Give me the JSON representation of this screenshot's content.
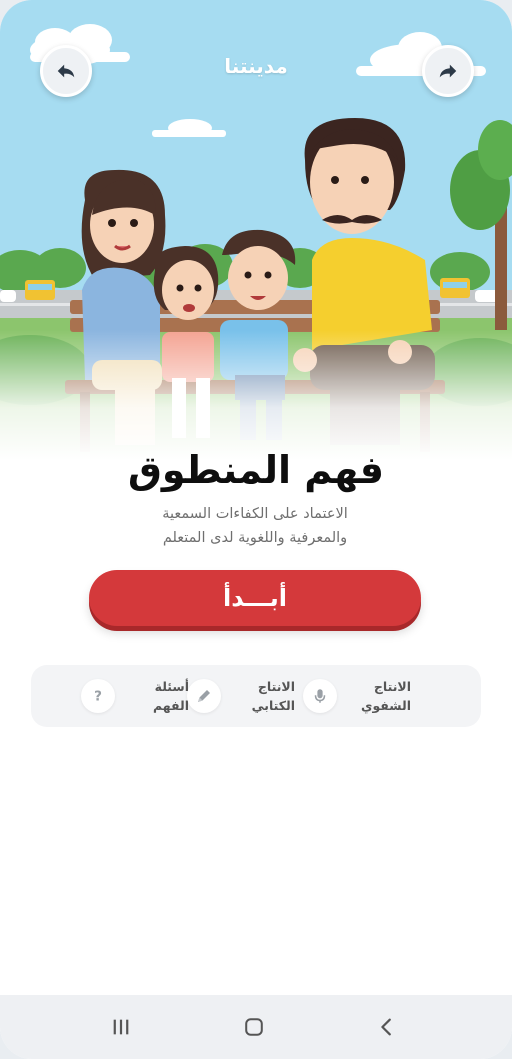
{
  "header": {
    "title": "مدينتنا",
    "back_icon": "arrow-back-icon",
    "forward_icon": "arrow-forward-icon"
  },
  "lesson": {
    "title": "فهم المنطوق",
    "subtitle_line1": "الاعتماد على الكفاءات السمعية",
    "subtitle_line2": "والمعرفية واللغوية لدى المتعلم"
  },
  "actions": {
    "start_label": "أبـــدأ"
  },
  "features": [
    {
      "label_line1": "الانتاج",
      "label_line2": "الشفوي",
      "icon": "microphone-icon"
    },
    {
      "label_line1": "الانتاج",
      "label_line2": "الكتابي",
      "icon": "pen-icon"
    },
    {
      "label_line1": "أسئلة",
      "label_line2": "الفهم",
      "icon": "question-icon"
    }
  ],
  "system_nav": {
    "recents_icon": "recents-icon",
    "home_icon": "home-icon",
    "back_icon": "back-chevron-icon"
  },
  "colors": {
    "sky": "#9dd7ef",
    "accent_red": "#d4393b",
    "title_text": "#0e0e0e",
    "subtitle_text": "#6f6f6f"
  }
}
